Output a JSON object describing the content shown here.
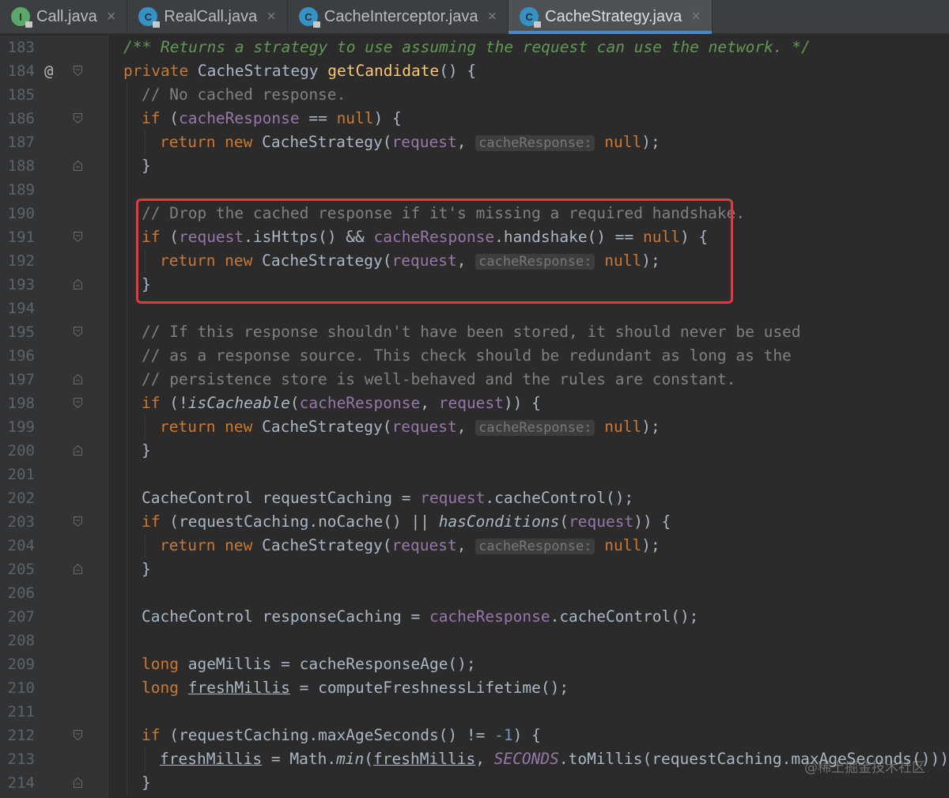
{
  "tabs": [
    {
      "label": "Call.java",
      "icon": "interface-icon",
      "icon_letter": "I",
      "active": false
    },
    {
      "label": "RealCall.java",
      "icon": "class-icon",
      "icon_letter": "C",
      "active": false
    },
    {
      "label": "CacheInterceptor.java",
      "icon": "class-icon",
      "icon_letter": "C",
      "active": false
    },
    {
      "label": "CacheStrategy.java",
      "icon": "class-icon",
      "icon_letter": "C",
      "active": true
    }
  ],
  "tab_close_glyph": "×",
  "override_marker": "@",
  "watermark": "@稀土掘金技术社区",
  "accent_color": "#4a88c7",
  "highlight_color": "#e8363f",
  "code_lines": [
    {
      "n": "183",
      "fold": "",
      "mark": "",
      "indent": 0,
      "html": "<span class='jd'>/** Returns a strategy to use assuming the request can use the network. */</span>"
    },
    {
      "n": "184",
      "fold": "open",
      "mark": "@",
      "indent": 0,
      "html": "<span class='kw'>private</span> CacheStrategy <span class='fn'>getCandidate</span>() {"
    },
    {
      "n": "185",
      "fold": "",
      "mark": "",
      "indent": 1,
      "html": "<span class='cm'>// No cached response.</span>"
    },
    {
      "n": "186",
      "fold": "open",
      "mark": "",
      "indent": 1,
      "html": "<span class='kw'>if</span> (<span class='fd'>cacheResponse</span> == <span class='kw'>null</span>) {"
    },
    {
      "n": "187",
      "fold": "",
      "mark": "",
      "indent": 2,
      "html": "<span class='kw'>return new</span> CacheStrategy(<span class='fd'>request</span>, <span class='hint'>cacheResponse:</span> <span class='kw'>null</span>);"
    },
    {
      "n": "188",
      "fold": "close",
      "mark": "",
      "indent": 1,
      "html": "}"
    },
    {
      "n": "189",
      "fold": "",
      "mark": "",
      "indent": 1,
      "html": ""
    },
    {
      "n": "190",
      "fold": "",
      "mark": "",
      "indent": 1,
      "html": "<span class='cm'>// Drop the cached response if it's missing a required handshake.</span>"
    },
    {
      "n": "191",
      "fold": "open",
      "mark": "",
      "indent": 1,
      "html": "<span class='kw'>if</span> (<span class='fd'>request</span>.isHttps() &amp;&amp; <span class='fd'>cacheResponse</span>.handshake() == <span class='kw'>null</span>) {"
    },
    {
      "n": "192",
      "fold": "",
      "mark": "",
      "indent": 2,
      "html": "<span class='kw'>return new</span> CacheStrategy(<span class='fd'>request</span>, <span class='hint'>cacheResponse:</span> <span class='kw'>null</span>);"
    },
    {
      "n": "193",
      "fold": "close",
      "mark": "",
      "indent": 1,
      "html": "}"
    },
    {
      "n": "194",
      "fold": "",
      "mark": "",
      "indent": 1,
      "html": ""
    },
    {
      "n": "195",
      "fold": "open",
      "mark": "",
      "indent": 1,
      "html": "<span class='cm'>// If this response shouldn't have been stored, it should never be used</span>"
    },
    {
      "n": "196",
      "fold": "",
      "mark": "",
      "indent": 1,
      "html": "<span class='cm'>// as a response source. This check should be redundant as long as the</span>"
    },
    {
      "n": "197",
      "fold": "close",
      "mark": "",
      "indent": 1,
      "html": "<span class='cm'>// persistence store is well-behaved and the rules are constant.</span>"
    },
    {
      "n": "198",
      "fold": "open",
      "mark": "",
      "indent": 1,
      "html": "<span class='kw'>if</span> (!<span class='it'>isCacheable</span>(<span class='fd'>cacheResponse</span>, <span class='fd'>request</span>)) {"
    },
    {
      "n": "199",
      "fold": "",
      "mark": "",
      "indent": 2,
      "html": "<span class='kw'>return new</span> CacheStrategy(<span class='fd'>request</span>, <span class='hint'>cacheResponse:</span> <span class='kw'>null</span>);"
    },
    {
      "n": "200",
      "fold": "close",
      "mark": "",
      "indent": 1,
      "html": "}"
    },
    {
      "n": "201",
      "fold": "",
      "mark": "",
      "indent": 1,
      "html": ""
    },
    {
      "n": "202",
      "fold": "",
      "mark": "",
      "indent": 1,
      "html": "CacheControl requestCaching = <span class='fd'>request</span>.cacheControl();"
    },
    {
      "n": "203",
      "fold": "open",
      "mark": "",
      "indent": 1,
      "html": "<span class='kw'>if</span> (requestCaching.noCache() || <span class='it'>hasConditions</span>(<span class='fd'>request</span>)) {"
    },
    {
      "n": "204",
      "fold": "",
      "mark": "",
      "indent": 2,
      "html": "<span class='kw'>return new</span> CacheStrategy(<span class='fd'>request</span>, <span class='hint'>cacheResponse:</span> <span class='kw'>null</span>);"
    },
    {
      "n": "205",
      "fold": "close",
      "mark": "",
      "indent": 1,
      "html": "}"
    },
    {
      "n": "206",
      "fold": "",
      "mark": "",
      "indent": 1,
      "html": ""
    },
    {
      "n": "207",
      "fold": "",
      "mark": "",
      "indent": 1,
      "html": "CacheControl responseCaching = <span class='fd'>cacheResponse</span>.cacheControl();"
    },
    {
      "n": "208",
      "fold": "",
      "mark": "",
      "indent": 1,
      "html": ""
    },
    {
      "n": "209",
      "fold": "",
      "mark": "",
      "indent": 1,
      "html": "<span class='kw'>long</span> ageMillis = cacheResponseAge();"
    },
    {
      "n": "210",
      "fold": "",
      "mark": "",
      "indent": 1,
      "html": "<span class='kw'>long</span> <span class='ul'>freshMillis</span> = computeFreshnessLifetime();"
    },
    {
      "n": "211",
      "fold": "",
      "mark": "",
      "indent": 1,
      "html": ""
    },
    {
      "n": "212",
      "fold": "open",
      "mark": "",
      "indent": 1,
      "html": "<span class='kw'>if</span> (requestCaching.maxAgeSeconds() != <span class='num'>-1</span>) {"
    },
    {
      "n": "213",
      "fold": "",
      "mark": "",
      "indent": 2,
      "html": "<span class='ul'>freshMillis</span> = Math.<span class='it'>min</span>(<span class='ul'>freshMillis</span>, <span class='fd it'>SECONDS</span>.toMillis(requestCaching.maxAgeSeconds()));"
    },
    {
      "n": "214",
      "fold": "close",
      "mark": "",
      "indent": 1,
      "html": "}"
    }
  ]
}
